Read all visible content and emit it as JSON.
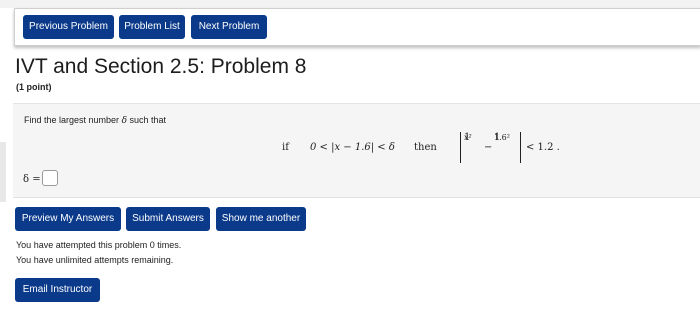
{
  "nav": {
    "previous_label": "Previous Problem",
    "list_label": "Problem List",
    "next_label": "Next Problem"
  },
  "header": {
    "title": "IVT and Section 2.5: Problem 8",
    "points": "(1 point)"
  },
  "problem": {
    "statement_prefix": "Find the largest number",
    "delta_symbol": "δ",
    "statement_suffix": "such that",
    "condition": {
      "if_word": "if",
      "lhs": "0 < |x − 1.6| < δ",
      "then_word": "then",
      "frac1_num": "1",
      "frac1_den": "x²",
      "minus": "−",
      "frac2_num": "1",
      "frac2_den": "1.6²",
      "rhs": "< 1.2 ."
    }
  },
  "answer": {
    "label": "δ =",
    "value": ""
  },
  "actions": {
    "preview_label": "Preview My Answers",
    "submit_label": "Submit Answers",
    "another_label": "Show me another"
  },
  "status": {
    "attempts": "You have attempted this problem 0 times.",
    "remaining": "You have unlimited attempts remaining."
  },
  "footer": {
    "email_label": "Email Instructor"
  },
  "colors": {
    "button_blue": "#0b3a8a",
    "panel_gray": "#f5f5f5"
  }
}
